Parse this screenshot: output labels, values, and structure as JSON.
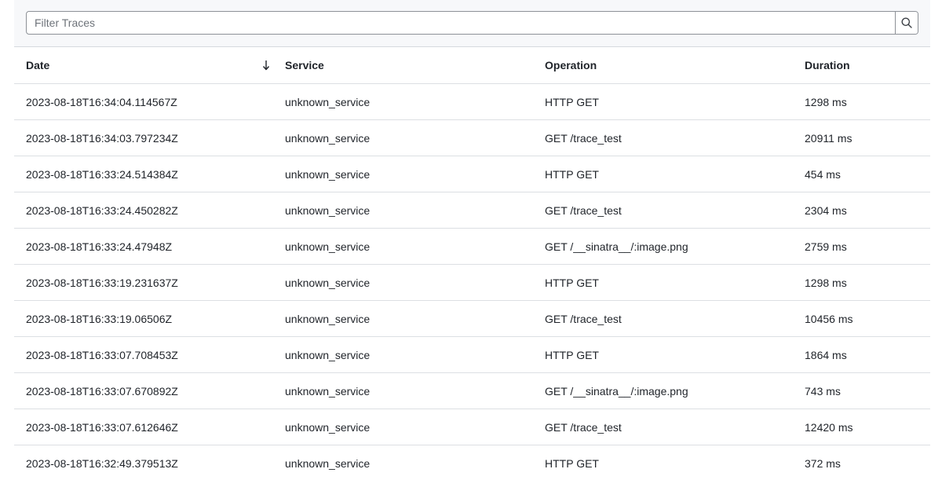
{
  "filter": {
    "placeholder": "Filter Traces",
    "value": ""
  },
  "icons": {
    "search": "search-icon",
    "sort": "arrow-down-icon"
  },
  "table": {
    "columns": {
      "date": "Date",
      "service": "Service",
      "operation": "Operation",
      "duration": "Duration"
    },
    "sort": {
      "column": "Date",
      "direction": "descending"
    },
    "rows": [
      {
        "date": "2023-08-18T16:34:04.114567Z",
        "service": "unknown_service",
        "operation": "HTTP GET",
        "duration": "1298 ms"
      },
      {
        "date": "2023-08-18T16:34:03.797234Z",
        "service": "unknown_service",
        "operation": "GET /trace_test",
        "duration": "20911 ms"
      },
      {
        "date": "2023-08-18T16:33:24.514384Z",
        "service": "unknown_service",
        "operation": "HTTP GET",
        "duration": "454 ms"
      },
      {
        "date": "2023-08-18T16:33:24.450282Z",
        "service": "unknown_service",
        "operation": "GET /trace_test",
        "duration": "2304 ms"
      },
      {
        "date": "2023-08-18T16:33:24.47948Z",
        "service": "unknown_service",
        "operation": "GET /__sinatra__/:image.png",
        "duration": "2759 ms"
      },
      {
        "date": "2023-08-18T16:33:19.231637Z",
        "service": "unknown_service",
        "operation": "HTTP GET",
        "duration": "1298 ms"
      },
      {
        "date": "2023-08-18T16:33:19.06506Z",
        "service": "unknown_service",
        "operation": "GET /trace_test",
        "duration": "10456 ms"
      },
      {
        "date": "2023-08-18T16:33:07.708453Z",
        "service": "unknown_service",
        "operation": "HTTP GET",
        "duration": "1864 ms"
      },
      {
        "date": "2023-08-18T16:33:07.670892Z",
        "service": "unknown_service",
        "operation": "GET /__sinatra__/:image.png",
        "duration": "743 ms"
      },
      {
        "date": "2023-08-18T16:33:07.612646Z",
        "service": "unknown_service",
        "operation": "GET /trace_test",
        "duration": "12420 ms"
      },
      {
        "date": "2023-08-18T16:32:49.379513Z",
        "service": "unknown_service",
        "operation": "HTTP GET",
        "duration": "372 ms"
      }
    ]
  }
}
